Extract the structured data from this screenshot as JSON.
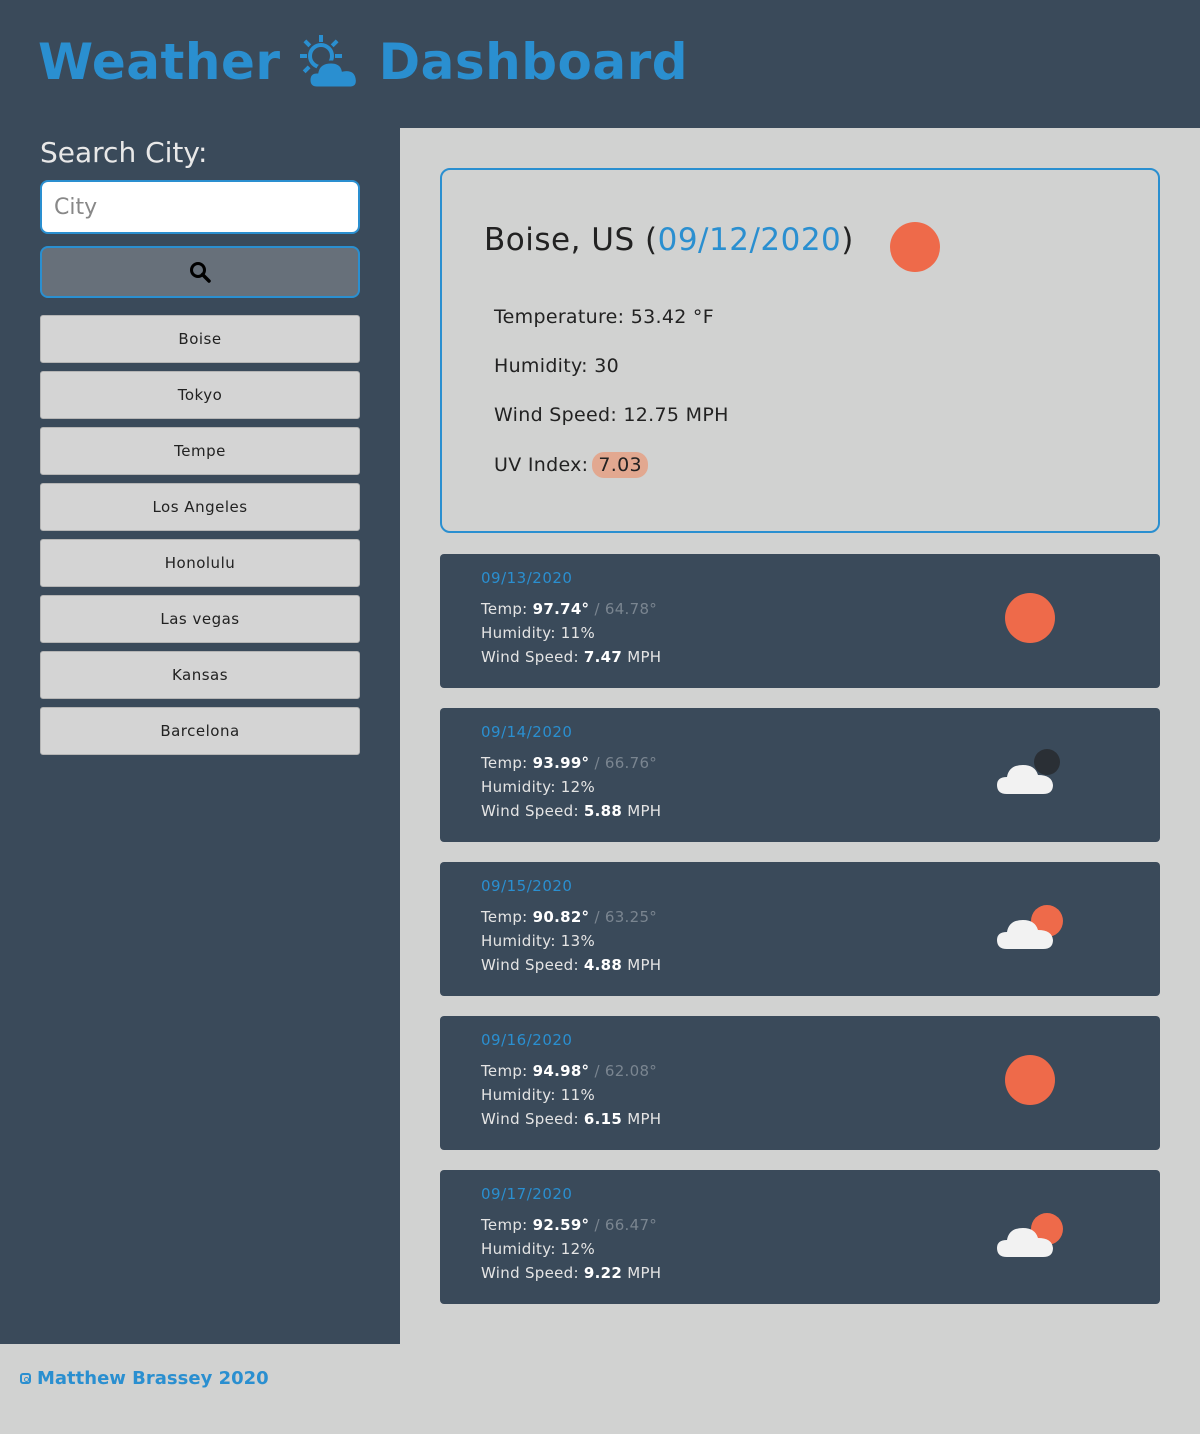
{
  "header": {
    "title_left": "Weather",
    "title_right": "Dashboard",
    "logo_icon": "sun-cloud-icon"
  },
  "sidebar": {
    "search_label": "Search City:",
    "search_placeholder": "City",
    "search_value": "",
    "search_icon": "search-icon",
    "history": [
      "Boise",
      "Tokyo",
      "Tempe",
      "Los Angeles",
      "Honolulu",
      "Las vegas",
      "Kansas",
      "Barcelona"
    ]
  },
  "current": {
    "city": "Boise, US",
    "date": "09/12/2020",
    "icon": "sun-icon",
    "temperature_label": "Temperature:",
    "temperature": "53.42 °F",
    "humidity_label": "Humidity:",
    "humidity": "30",
    "wind_label": "Wind Speed:",
    "wind": "12.75 MPH",
    "uv_label": "UV Index:",
    "uv": "7.03"
  },
  "forecast": [
    {
      "date": "09/13/2020",
      "high": "97.74°",
      "low": "/ 64.78°",
      "humidity": "11%",
      "wind": "7.47",
      "icon": "sun-icon"
    },
    {
      "date": "09/14/2020",
      "high": "93.99°",
      "low": "/ 66.76°",
      "humidity": "12%",
      "wind": "5.88",
      "icon": "night-cloud-icon"
    },
    {
      "date": "09/15/2020",
      "high": "90.82°",
      "low": "/ 63.25°",
      "humidity": "13%",
      "wind": "4.88",
      "icon": "partly-cloudy-icon"
    },
    {
      "date": "09/16/2020",
      "high": "94.98°",
      "low": "/ 62.08°",
      "humidity": "11%",
      "wind": "6.15",
      "icon": "sun-icon"
    },
    {
      "date": "09/17/2020",
      "high": "92.59°",
      "low": "/ 66.47°",
      "humidity": "12%",
      "wind": "9.22",
      "icon": "partly-cloudy-icon"
    }
  ],
  "forecast_labels": {
    "temp": "Temp:",
    "humidity": "Humidity:",
    "wind": "Wind Speed:",
    "wind_unit": "MPH"
  },
  "footer": {
    "text": "Matthew Brassey 2020",
    "icon": "instagram-icon"
  },
  "colors": {
    "accent": "#2a8fd0",
    "panel": "#3a4a5a",
    "background": "#d1d2d1",
    "sun": "#ee6a4a",
    "uv_badge": "#e2a890"
  }
}
